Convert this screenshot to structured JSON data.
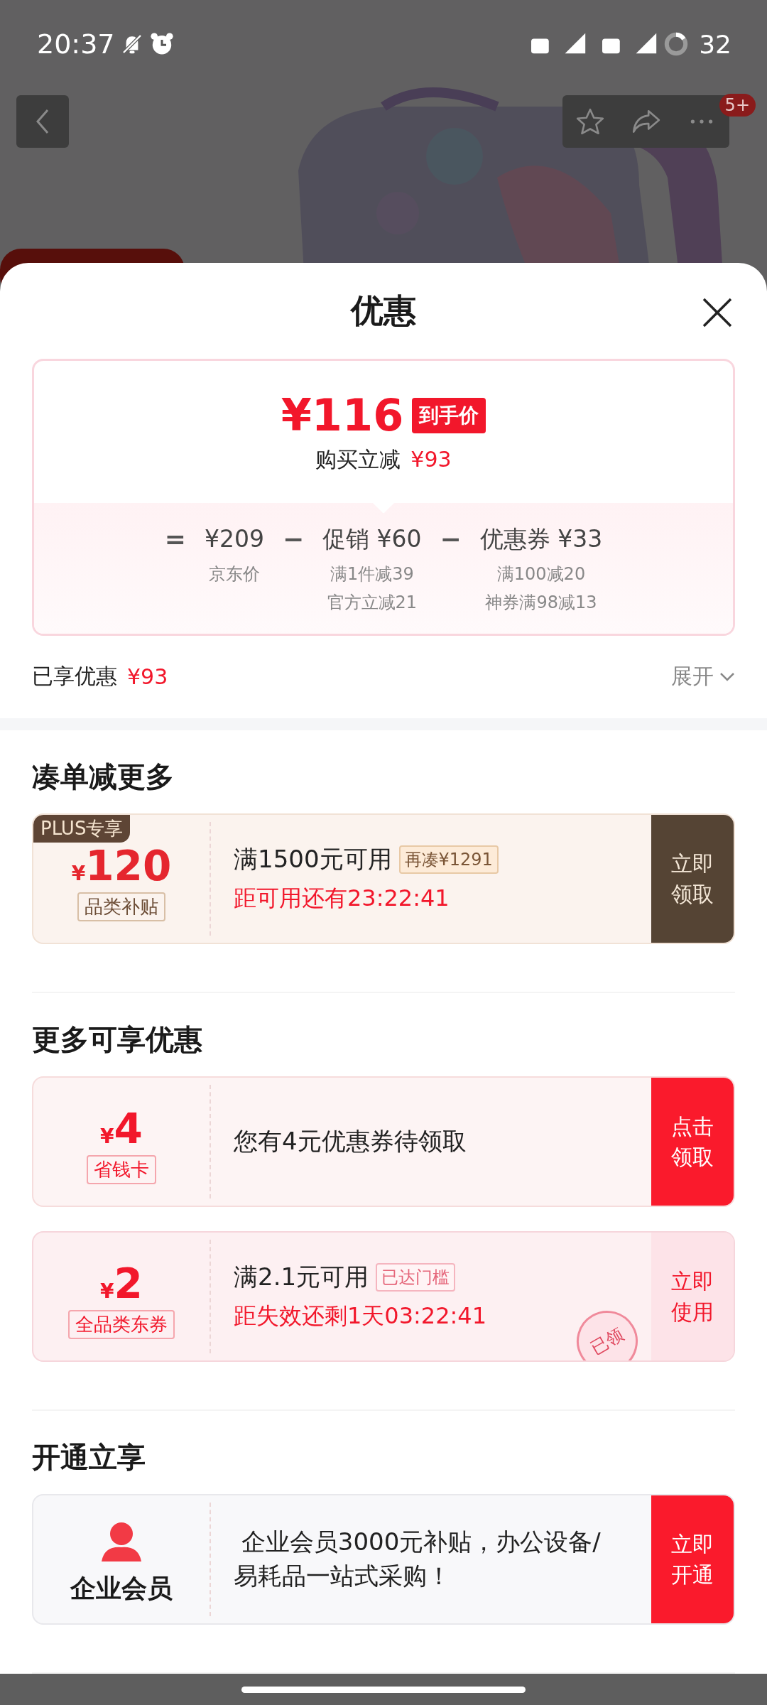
{
  "status_bar": {
    "time": "20:37",
    "battery": "32"
  },
  "top_nav": {
    "badge": "5+"
  },
  "sheet": {
    "title": "优惠",
    "price_card": {
      "final_price": "¥116",
      "final_tag": "到手价",
      "saving_label": "购买立减",
      "saving_amount": "¥93",
      "terms": [
        {
          "operator": "=",
          "amount": "¥209",
          "notes": [
            "京东价"
          ]
        },
        {
          "operator": "−",
          "amount": "促销 ¥60",
          "notes": [
            "满1件减39",
            "官方立减21"
          ]
        },
        {
          "operator": "−",
          "amount": "优惠券 ¥33",
          "notes": [
            "满100减20",
            "神券满98减13"
          ]
        }
      ]
    },
    "enjoyed": {
      "label": "已享优惠",
      "amount": "¥93",
      "expand": "展开"
    },
    "sections": [
      {
        "heading": "凑单减更多",
        "coupons": [
          {
            "kind": "plus",
            "badge": "PLUS专享",
            "amount": "120",
            "currency": "¥",
            "tag": "品类补贴",
            "title": "满1500元可用",
            "chip": "再凑¥1291",
            "countdown": "距可用还有23:22:41",
            "button": "立即领取"
          }
        ]
      },
      {
        "heading": "更多可享优惠",
        "coupons": [
          {
            "kind": "red",
            "amount": "4",
            "currency": "¥",
            "tag": "省钱卡",
            "title": "您有4元优惠券待领取",
            "button": "点击领取"
          },
          {
            "kind": "pink",
            "amount": "2",
            "currency": "¥",
            "tag": "全品类东券",
            "title": "满2.1元可用",
            "chip": "已达门槛",
            "countdown": "距失效还剩1天03:22:41",
            "button": "立即使用",
            "stamp": "已领"
          }
        ]
      },
      {
        "heading": "开通立享",
        "coupons": [
          {
            "kind": "member",
            "tag": "企业会员",
            "title": " 企业会员3000元补贴，办公设备/易耗品一站式采购！",
            "button": "立即开通"
          }
        ]
      }
    ]
  }
}
